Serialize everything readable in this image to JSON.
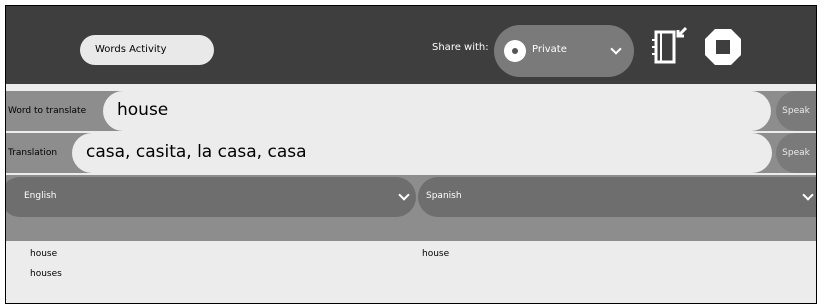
{
  "toolbar": {
    "activity_title": "Words Activity",
    "share_label": "Share with:",
    "share_value": "Private"
  },
  "word_row": {
    "label": "Word to translate",
    "value": "house",
    "speak_label": "Speak"
  },
  "translation_row": {
    "label": "Translation",
    "value": "casa, casita, la casa, casa",
    "speak_label": "Speak"
  },
  "languages": {
    "source": "English",
    "target": "Spanish"
  },
  "lists": {
    "source_words": [
      "house",
      "houses"
    ],
    "target_words": [
      "house"
    ]
  },
  "colors": {
    "toolbar": "#3e3e3e",
    "panel": "#8d8d8d",
    "entry": "#ececec"
  }
}
